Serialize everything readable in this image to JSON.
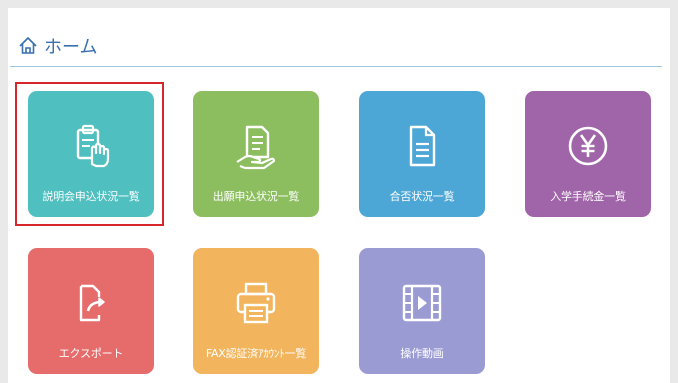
{
  "header": {
    "title": "ホーム",
    "icon": "home-icon"
  },
  "tiles": [
    {
      "label": "説明会申込状況一覧",
      "icon": "clipboard-hand-icon",
      "color": "#4fbfbf"
    },
    {
      "label": "出願申込状況一覧",
      "icon": "document-hand-icon",
      "color": "#8cbd5f"
    },
    {
      "label": "合否状況一覧",
      "icon": "document-icon",
      "color": "#4da7d6"
    },
    {
      "label": "入学手続金一覧",
      "icon": "yen-circle-icon",
      "color": "#a064a8"
    },
    {
      "label": "エクスポート",
      "icon": "export-icon",
      "color": "#e66b6b"
    },
    {
      "label": "FAX認証済ｱｶｳﾝﾄ一覧",
      "icon": "printer-icon",
      "color": "#f2b45c"
    },
    {
      "label": "操作動画",
      "icon": "film-icon",
      "color": "#9b9bd4"
    }
  ],
  "highlight_color": "#d4262b"
}
